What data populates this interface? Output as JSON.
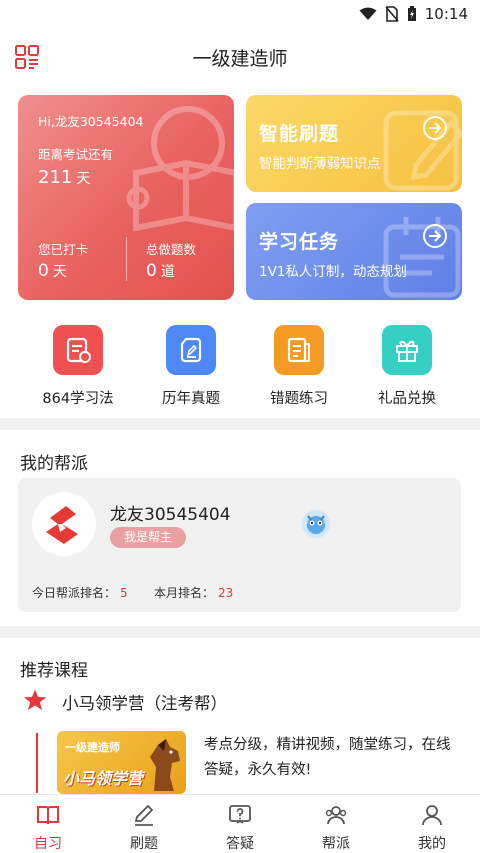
{
  "status_bar": {
    "time": "10:14"
  },
  "header": {
    "title": "一级建造师"
  },
  "stats_card": {
    "greeting": "Hi,龙友30545404",
    "countdown_label": "距离考试还有",
    "countdown_value": "211",
    "countdown_unit": "天",
    "checkin_label": "您已打卡",
    "checkin_value": "0",
    "checkin_unit": "天",
    "total_label": "总做题数",
    "total_value": "0",
    "total_unit": "道"
  },
  "smart_card": {
    "title": "智能刷题",
    "subtitle": "智能判断薄弱知识点"
  },
  "task_card": {
    "title": "学习任务",
    "subtitle": "1V1私人订制，动态规划"
  },
  "quick_actions": [
    {
      "label": "864学习法",
      "icon": "study-method-icon",
      "color": "#f25050"
    },
    {
      "label": "历年真题",
      "icon": "past-papers-icon",
      "color": "#4d88f5"
    },
    {
      "label": "错题练习",
      "icon": "wrong-questions-icon",
      "color": "#f59a23"
    },
    {
      "label": "礼品兑换",
      "icon": "gift-icon",
      "color": "#36cfc4"
    }
  ],
  "gang_section": {
    "title": "我的帮派",
    "name": "龙友30545404",
    "badge": "我是帮主",
    "today_rank_label": "今日帮派排名：",
    "today_rank_value": "5",
    "month_rank_label": "本月排名：",
    "month_rank_value": "23"
  },
  "course_section": {
    "title": "推荐课程",
    "course_name": "小马领学营（注考帮）",
    "thumb_line1": "一级建造师",
    "thumb_line2": "小马领学营",
    "description": "考点分级，精讲视频，随堂练习，在线答疑，永久有效!"
  },
  "tabbar": [
    {
      "label": "自习",
      "icon": "book-icon",
      "active": true
    },
    {
      "label": "刷题",
      "icon": "pencil-icon",
      "active": false
    },
    {
      "label": "答疑",
      "icon": "question-icon",
      "active": false
    },
    {
      "label": "帮派",
      "icon": "group-icon",
      "active": false
    },
    {
      "label": "我的",
      "icon": "user-icon",
      "active": false
    }
  ],
  "colors": {
    "accent": "#e53935",
    "red_card": "#e9625f",
    "yellow_card": "#f6c140",
    "blue_card": "#5f7fe6"
  }
}
